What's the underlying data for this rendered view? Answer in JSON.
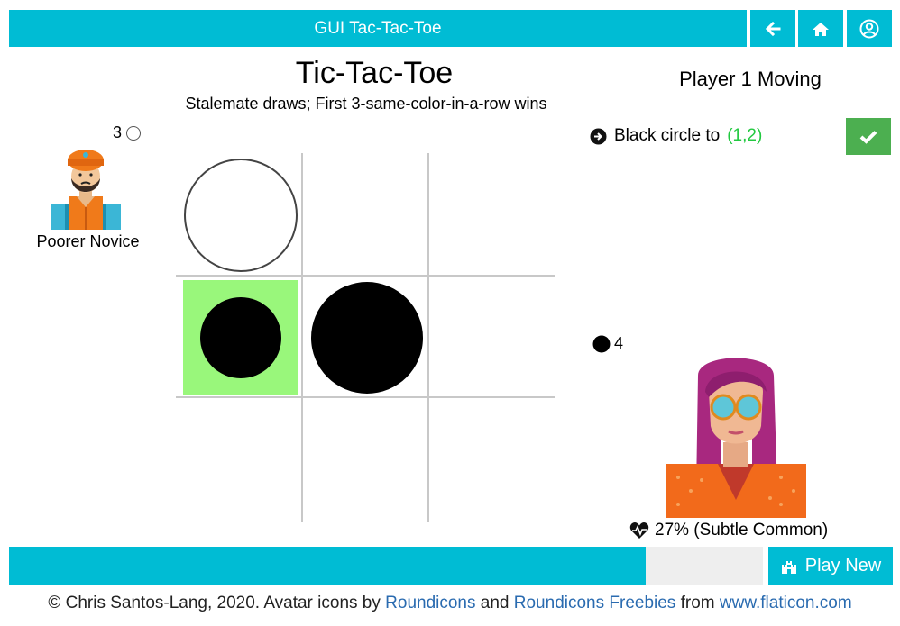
{
  "header": {
    "title": "GUI Tac-Tac-Toe",
    "nav": [
      {
        "name": "back-arrow-icon"
      },
      {
        "name": "home-icon"
      },
      {
        "name": "user-account-icon"
      }
    ]
  },
  "game": {
    "title": "Tic-Tac-Toe",
    "subtitle": "Stalemate draws; First 3-same-color-in-a-row wins",
    "turn_status": "Player 1 Moving"
  },
  "player_left": {
    "score": "3",
    "piece": "white-circle",
    "name": "Poorer Novice"
  },
  "player_right": {
    "score": "4",
    "piece": "black-circle",
    "rating": "27% (Subtle Common)"
  },
  "move": {
    "text": "Black circle to",
    "coord": "(1,2)"
  },
  "board": {
    "rows": 3,
    "cols": 3,
    "cells": [
      [
        {
          "piece": "white",
          "highlight": false
        },
        {
          "piece": "",
          "highlight": false
        },
        {
          "piece": "",
          "highlight": false
        }
      ],
      [
        {
          "piece": "black",
          "highlight": true
        },
        {
          "piece": "black",
          "highlight": false
        },
        {
          "piece": "",
          "highlight": false
        }
      ],
      [
        {
          "piece": "",
          "highlight": false
        },
        {
          "piece": "",
          "highlight": false
        },
        {
          "piece": "",
          "highlight": false
        }
      ]
    ],
    "highlight_color": "#99f77b"
  },
  "actions": {
    "play_new": "Play New"
  },
  "footer": {
    "prefix": "© Chris Santos-Lang, 2020. Avatar icons by ",
    "link1": "Roundicons",
    "and": " and ",
    "link2": "Roundicons Freebies",
    "from": " from ",
    "link3": "www.flaticon.com"
  },
  "colors": {
    "accent": "#00bcd4",
    "confirm": "#4caf50",
    "coord": "#22c940",
    "link": "#2a6bb0"
  }
}
